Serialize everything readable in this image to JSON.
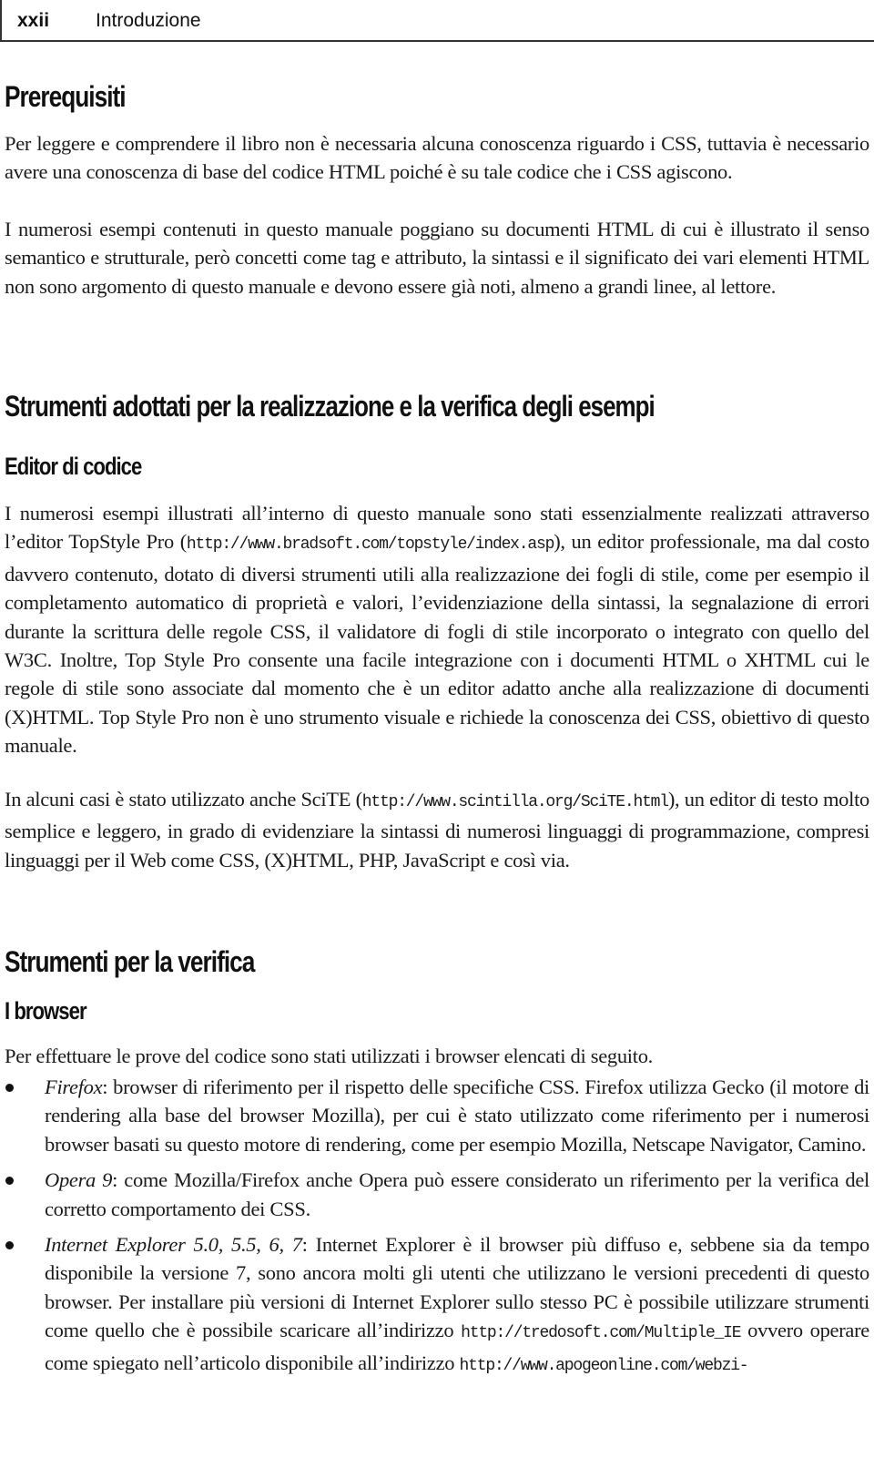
{
  "header": {
    "page_number": "xxii",
    "chapter": "Introduzione"
  },
  "sections": {
    "prerequisiti": {
      "title": "Prerequisiti",
      "p1": "Per leggere e comprendere il libro non è necessaria alcuna conoscenza riguardo i CSS, tuttavia è necessario avere una conoscenza di base del codice HTML poiché è su tale codice che i CSS agiscono.",
      "p2": "I numerosi esempi contenuti in questo manuale poggiano su documenti HTML di cui è illustrato il senso semantico e strutturale, però concetti come tag e attributo, la sintassi e il significato dei vari elementi HTML non sono argomento di questo manuale e devono essere già noti, almeno a grandi linee, al lettore."
    },
    "strumenti_adottati": {
      "title": "Strumenti adottati per la realizzazione e la verifica degli esempi",
      "subtitle": "Editor di codice",
      "p1_a": "I numerosi esempi illustrati all’interno di questo manuale sono stati essenzialmente realizzati attraverso l’editor TopStyle Pro (",
      "p1_url": "http://www.bradsoft.com/topstyle/index.asp",
      "p1_b": "), un editor professionale, ma dal costo davvero contenuto, dotato di diversi strumenti utili alla realizzazione dei fogli di stile, come per esempio il completamento automatico di proprietà e valori, l’evidenziazione della sintassi, la segnalazione di errori durante la scrittura delle regole CSS, il validatore di fogli di stile incorporato o integrato con quello del W3C. Inoltre, Top Style Pro consente una facile integrazione con i documenti HTML o XHTML cui le regole di stile sono associate dal momento che è un editor adatto anche alla realizzazione di documenti (X)HTML. Top Style Pro non è uno strumento visuale e richiede la conoscenza dei CSS, obiettivo di questo manuale.",
      "p2_a": "In alcuni casi è stato utilizzato anche SciTE (",
      "p2_url": "http://www.scintilla.org/SciTE.html",
      "p2_b": "), un editor di testo molto semplice e leggero, in grado di evidenziare la sintassi di numerosi linguaggi di programmazione, compresi linguaggi per il Web come CSS, (X)HTML, PHP, JavaScript e così via."
    },
    "strumenti_verifica": {
      "title": "Strumenti per la verifica",
      "subtitle": "I browser",
      "intro": "Per effettuare le prove del codice sono stati utilizzati i browser elencati di seguito.",
      "items": [
        {
          "name": "Firefox",
          "text": ": browser di riferimento per il rispetto delle specifiche CSS. Firefox utilizza Gecko (il motore di rendering alla base del browser Mozilla), per cui è stato utilizzato come riferimento per i numerosi browser basati su questo motore di rendering, come per esempio Mozilla, Netscape Navigator, Camino."
        },
        {
          "name": "Opera 9",
          "text": ": come Mozilla/Firefox anche Opera può essere considerato un riferimento per la verifica del corretto comportamento dei CSS."
        },
        {
          "name": "Internet Explorer 5.0, 5.5, 6, 7",
          "text_a": ": Internet Explorer è il browser più diffuso e, sebbene sia da tempo disponibile la versione 7, sono ancora molti gli utenti che utilizzano le versioni precedenti di questo browser. Per installare più versioni di Internet Explorer sullo stesso PC è possibile utilizzare strumenti come quello che è possibile scaricare all’indirizzo ",
          "url1": "http://tredosoft.com/Multiple_IE",
          "text_b": " ovvero operare come spiegato nell’articolo disponibile all’indirizzo ",
          "url2": "http://www.apogeonline.com/webzi-"
        }
      ]
    }
  }
}
